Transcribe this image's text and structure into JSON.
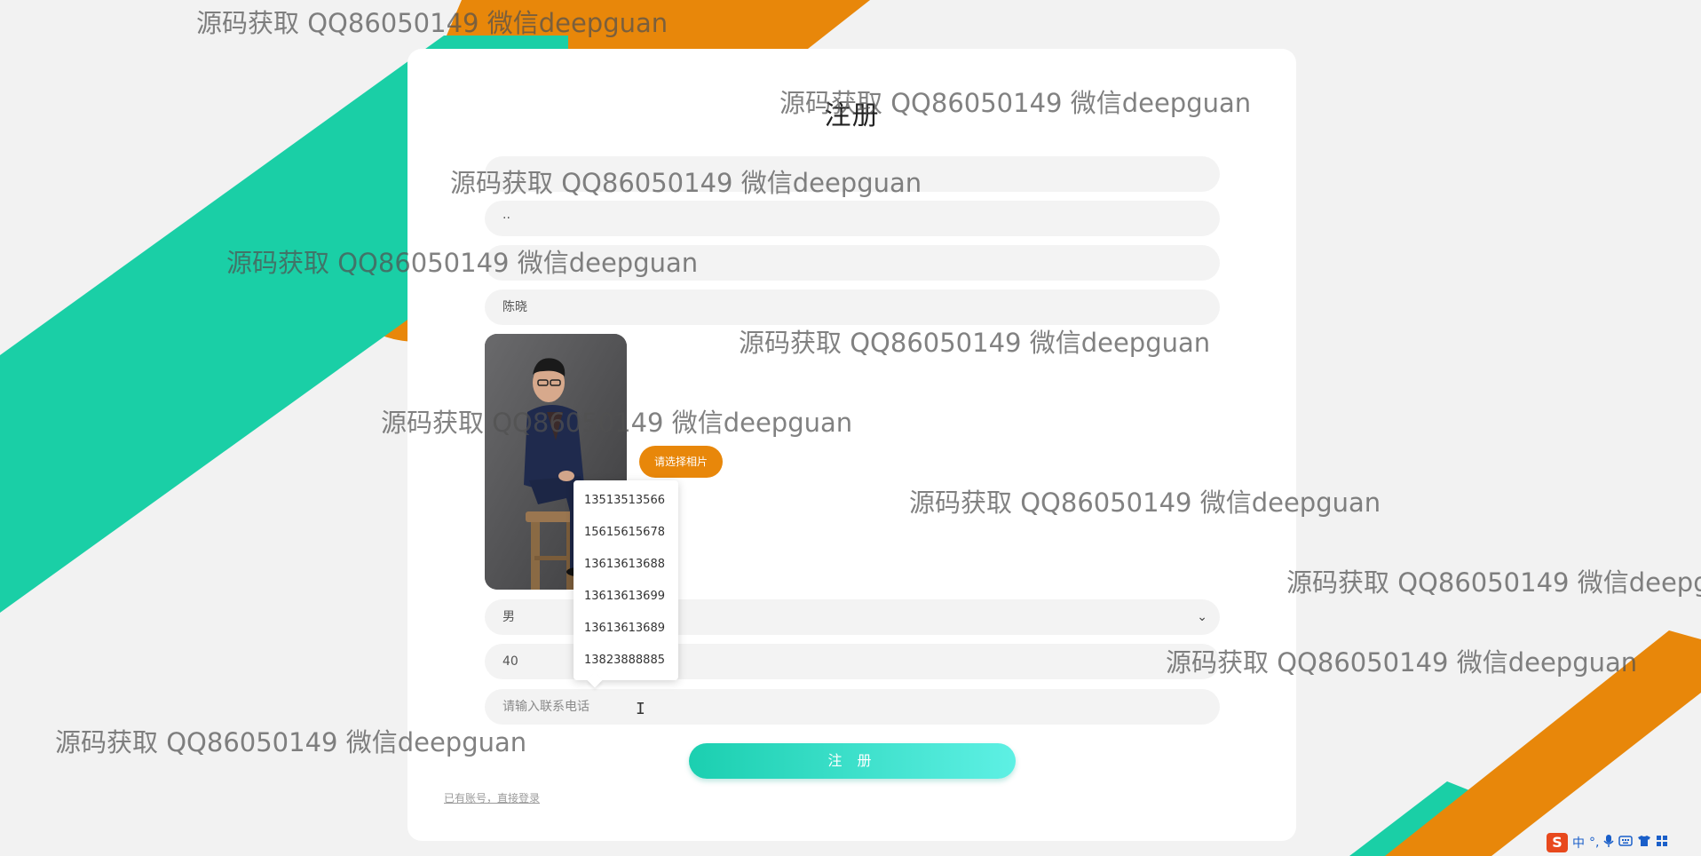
{
  "form": {
    "title": "注册",
    "field1_value": "",
    "field2_value": "··",
    "field3_value": "",
    "name_value": "陈晓",
    "choose_photo_label": "请选择相片",
    "gender_value": "男",
    "age_value": "40",
    "phone_placeholder": "请输入联系电话",
    "register_label": "注 册",
    "login_link": "已有账号，直接登录"
  },
  "dropdown": {
    "items": [
      "13513513566",
      "15615615678",
      "13613613688",
      "13613613699",
      "13613613689",
      "13823888885"
    ]
  },
  "watermark": "源码获取 QQ86050149 微信deepguan",
  "taskbar": {
    "ime_logo": "S",
    "ime_lang": "中",
    "punct": "°,"
  },
  "colors": {
    "teal": "#1acfa6",
    "orange": "#e8870a",
    "button_gradient_start": "#1bcfb0",
    "button_gradient_end": "#5ef0e4"
  }
}
